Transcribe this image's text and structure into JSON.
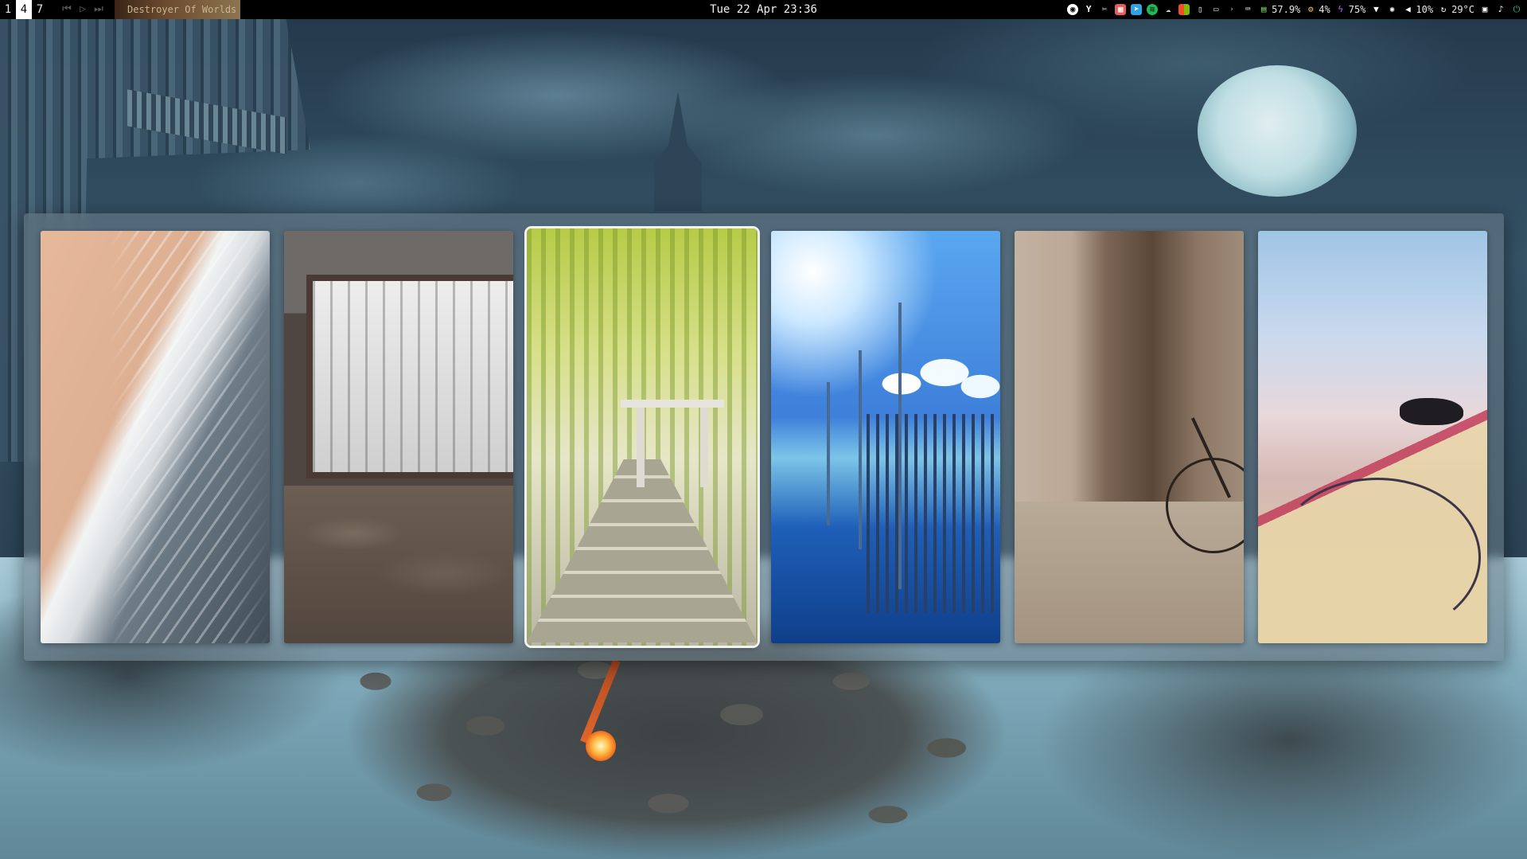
{
  "topbar": {
    "workspaces": [
      "1",
      "4",
      "7"
    ],
    "active_workspace": "4",
    "now_playing": "Destroyer Of Worlds",
    "clock": "Tue 22 Apr 23:36",
    "tray": {
      "memory": "57.9%",
      "cpu": "4%",
      "battery": "75%",
      "volume": "10%",
      "temperature": "29°C"
    }
  },
  "picker": {
    "wallpapers": [
      {
        "name": "beach-waves"
      },
      {
        "name": "snowy-window-bed"
      },
      {
        "name": "bamboo-torii-path"
      },
      {
        "name": "blue-sky-pier-lamps"
      },
      {
        "name": "sepia-bicycle-alley"
      },
      {
        "name": "pastel-bicycle-wall"
      }
    ],
    "selected_index": 2
  },
  "colors": {
    "bar_bg": "#000000",
    "active_ws_bg": "#ffffff",
    "panel_bg": "#6e808c",
    "selection_outline": "#f2f2f2",
    "spotify_green": "#1db954",
    "memory_green": "#7bd66b",
    "cpu_yellow": "#e6c84a",
    "battery_yellow": "#f3d94a"
  }
}
